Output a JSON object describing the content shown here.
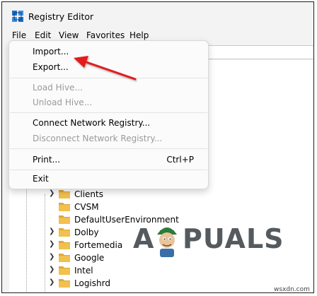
{
  "window": {
    "title": "Registry Editor"
  },
  "menubar": {
    "items": [
      "File",
      "Edit",
      "View",
      "Favorites",
      "Help"
    ]
  },
  "file_menu": {
    "groups": [
      {
        "items": [
          {
            "label": "Import...",
            "enabled": true
          },
          {
            "label": "Export...",
            "enabled": true
          }
        ]
      },
      {
        "items": [
          {
            "label": "Load Hive...",
            "enabled": false
          },
          {
            "label": "Unload Hive...",
            "enabled": false
          }
        ]
      },
      {
        "items": [
          {
            "label": "Connect Network Registry...",
            "enabled": true
          },
          {
            "label": "Disconnect Network Registry...",
            "enabled": false
          }
        ]
      },
      {
        "items": [
          {
            "label": "Print...",
            "enabled": true,
            "shortcut": "Ctrl+P"
          }
        ]
      },
      {
        "items": [
          {
            "label": "Exit",
            "enabled": true
          }
        ]
      }
    ]
  },
  "tree": {
    "items": [
      {
        "label": "Clients",
        "expandable": true
      },
      {
        "label": "CVSM",
        "expandable": false
      },
      {
        "label": "DefaultUserEnvironment",
        "expandable": false
      },
      {
        "label": "Dolby",
        "expandable": true
      },
      {
        "label": "Fortemedia",
        "expandable": true
      },
      {
        "label": "Google",
        "expandable": true
      },
      {
        "label": "Intel",
        "expandable": true
      },
      {
        "label": "Logishrd",
        "expandable": true
      }
    ]
  },
  "watermark": {
    "left": "A",
    "right": "PUALS"
  },
  "credit": {
    "text": "wsxdn.com"
  },
  "colors": {
    "arrow": "#e21b1b",
    "folder": "#f2c04d",
    "folder_dark": "#dea73a"
  }
}
